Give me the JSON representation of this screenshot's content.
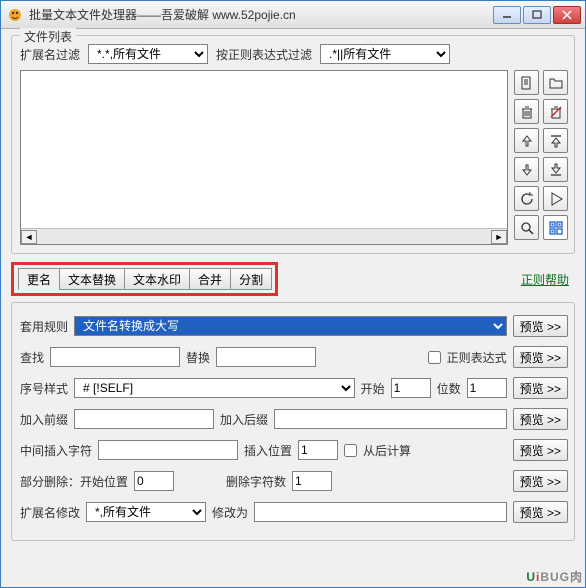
{
  "window": {
    "title": "批量文本文件处理器——吾爱破解 www.52pojie.cn"
  },
  "fileList": {
    "groupTitle": "文件列表",
    "extFilterLabel": "扩展名过滤",
    "extFilterValue": "*.*,所有文件",
    "regexFilterLabel": "按正则表达式过滤",
    "regexFilterValue": ".*||所有文件"
  },
  "tabs": {
    "items": [
      "更名",
      "文本替换",
      "文本水印",
      "合并",
      "分割"
    ],
    "regexHelp": "正则帮助"
  },
  "form": {
    "ruleLabel": "套用规则",
    "ruleValue": "文件名转换成大写",
    "findLabel": "查找",
    "replaceLabel": "替换",
    "regexChkLabel": "正则表达式",
    "seqStyleLabel": "序号样式",
    "seqStyleValue": "# [!SELF]",
    "startLabel": "开始",
    "startValue": "1",
    "digitsLabel": "位数",
    "digitsValue": "1",
    "prefixLabel": "加入前缀",
    "suffixLabel": "加入后缀",
    "insertLabel": "中间插入字符",
    "insertPosLabel": "插入位置",
    "insertPosValue": "1",
    "fromEndLabel": "从后计算",
    "partialDeleteLabel": "部分删除：开始位置",
    "delStartValue": "0",
    "delCountLabel": "删除字符数",
    "delCountValue": "1",
    "extModifyLabel": "扩展名修改",
    "extModifyValue": "*,所有文件",
    "modifyToLabel": "修改为",
    "previewBtn": "预览 >>"
  },
  "watermark": "uiBUG"
}
